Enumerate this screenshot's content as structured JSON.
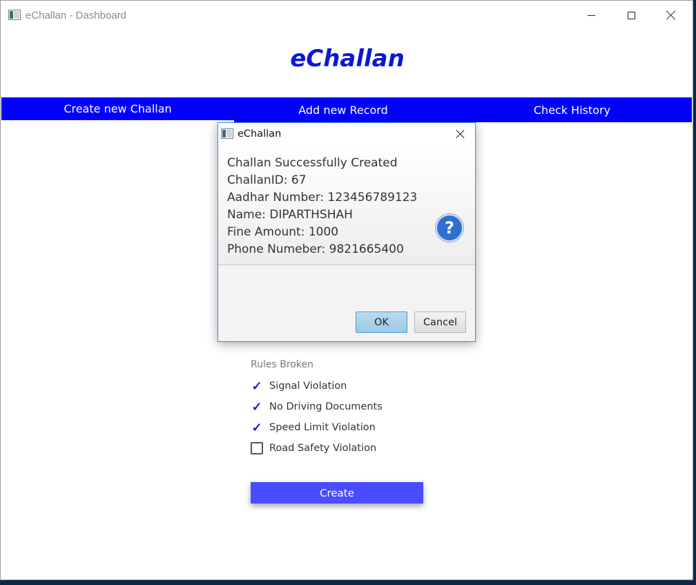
{
  "window": {
    "title": "eChallan - Dashboard"
  },
  "app": {
    "brand": "eChallan"
  },
  "nav": {
    "items": [
      "Create new Challan",
      "Add new Record",
      "Check History"
    ]
  },
  "form": {
    "rules_label": "Rules Broken",
    "rules": [
      {
        "label": "Signal Violation",
        "checked": true
      },
      {
        "label": "No Driving Documents",
        "checked": true
      },
      {
        "label": "Speed Limit Violation",
        "checked": true
      },
      {
        "label": "Road Safety Violation",
        "checked": false
      }
    ],
    "create_label": "Create"
  },
  "dialog": {
    "title": "eChallan",
    "lines": [
      "Challan Successfully Created",
      "ChallanID: 67",
      "Aadhar Number: 123456789123",
      "Name: DIPARTHSHAH",
      "Fine Amount: 1000",
      "Phone Numeber: 9821665400"
    ],
    "icon_glyph": "?",
    "ok_label": "OK",
    "cancel_label": "Cancel"
  },
  "icons": {
    "check": "✓"
  },
  "colors": {
    "brand": "#0d16d8",
    "navbar": "#0000ff",
    "create_button": "#4a4cff",
    "check": "#1a1ad8"
  }
}
